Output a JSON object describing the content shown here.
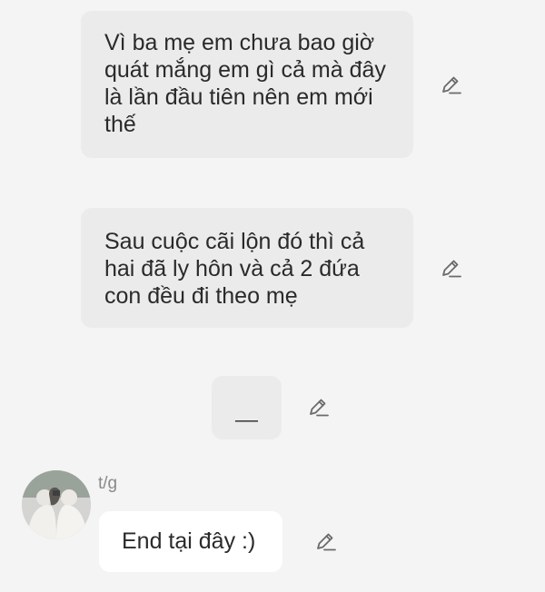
{
  "messages": [
    {
      "text": "Vì ba mẹ em chưa bao giờ quát mắng em gì cả mà đây là lần đầu tiên nên em mới thế"
    },
    {
      "text": "Sau cuộc cãi lộn đó thì cả hai đã ly hôn và cả 2 đứa con đều đi theo mẹ"
    },
    {
      "text": "__"
    }
  ],
  "reply": {
    "sender": "t/g",
    "text": "End tại đây :)"
  },
  "icons": {
    "edit": "pencil-edit-icon",
    "avatar": "user-avatar"
  }
}
